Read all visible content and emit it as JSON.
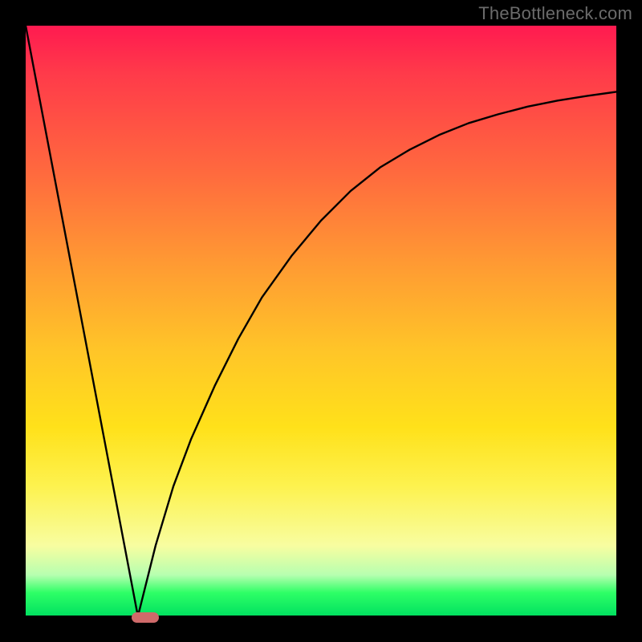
{
  "watermark": {
    "text": "TheBottleneck.com"
  },
  "colors": {
    "gradient_top": "#ff1a50",
    "gradient_bottom": "#00e060",
    "curve_stroke": "#000000",
    "marker_fill": "#cf6a6a",
    "frame_bg": "#000000"
  },
  "chart_data": {
    "type": "line",
    "title": "",
    "xlabel": "",
    "ylabel": "",
    "xlim": [
      0,
      100
    ],
    "ylim": [
      0,
      100
    ],
    "legend": false,
    "grid": false,
    "series": [
      {
        "name": "left-linear",
        "x": [
          0,
          19
        ],
        "values": [
          100,
          0
        ]
      },
      {
        "name": "right-curve",
        "x": [
          19,
          22,
          25,
          28,
          32,
          36,
          40,
          45,
          50,
          55,
          60,
          65,
          70,
          75,
          80,
          85,
          90,
          95,
          100
        ],
        "values": [
          0,
          12,
          22,
          30,
          39,
          47,
          54,
          61,
          67,
          72,
          76,
          79,
          81.5,
          83.5,
          85,
          86.3,
          87.3,
          88.1,
          88.8
        ]
      }
    ],
    "marker": {
      "x_start": 18,
      "x_end": 22.5,
      "y": 0
    },
    "background_gradient": {
      "direction": "vertical",
      "stops": [
        {
          "t": 0.0,
          "color": "#ff1a50"
        },
        {
          "t": 0.25,
          "color": "#ff6a3e"
        },
        {
          "t": 0.55,
          "color": "#ffc528"
        },
        {
          "t": 0.78,
          "color": "#fdf24f"
        },
        {
          "t": 0.93,
          "color": "#b7ffb0"
        },
        {
          "t": 1.0,
          "color": "#00e060"
        }
      ]
    }
  }
}
